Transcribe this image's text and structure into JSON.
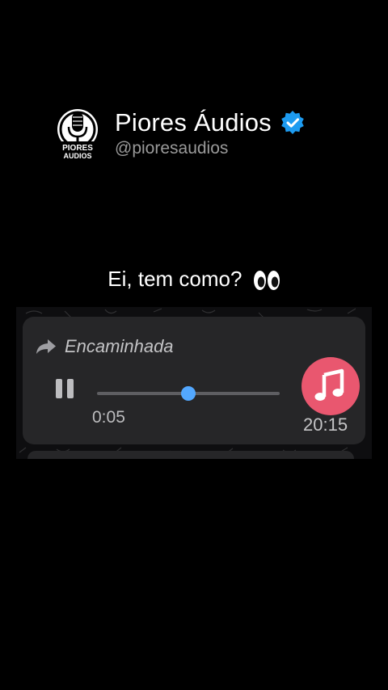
{
  "channel": {
    "name": "Piores Áudios",
    "handle": "@pioresaudios",
    "logo_text_top": "PIORES",
    "logo_text_bottom": "AUDIOS",
    "verified_color": "#1d9bf0"
  },
  "caption": {
    "text": "Ei, tem como?",
    "emoji": "eyes-emoji"
  },
  "voice_message": {
    "forwarded_label": "Encaminhada",
    "elapsed": "0:05",
    "duration": "20:15",
    "progress_fraction": 0.5,
    "state": "playing",
    "accent_color": "#53a8ff",
    "avatar_color": "#e9576f",
    "icons": [
      "forward-arrow-icon",
      "pause-icon",
      "music-note-icon"
    ]
  }
}
